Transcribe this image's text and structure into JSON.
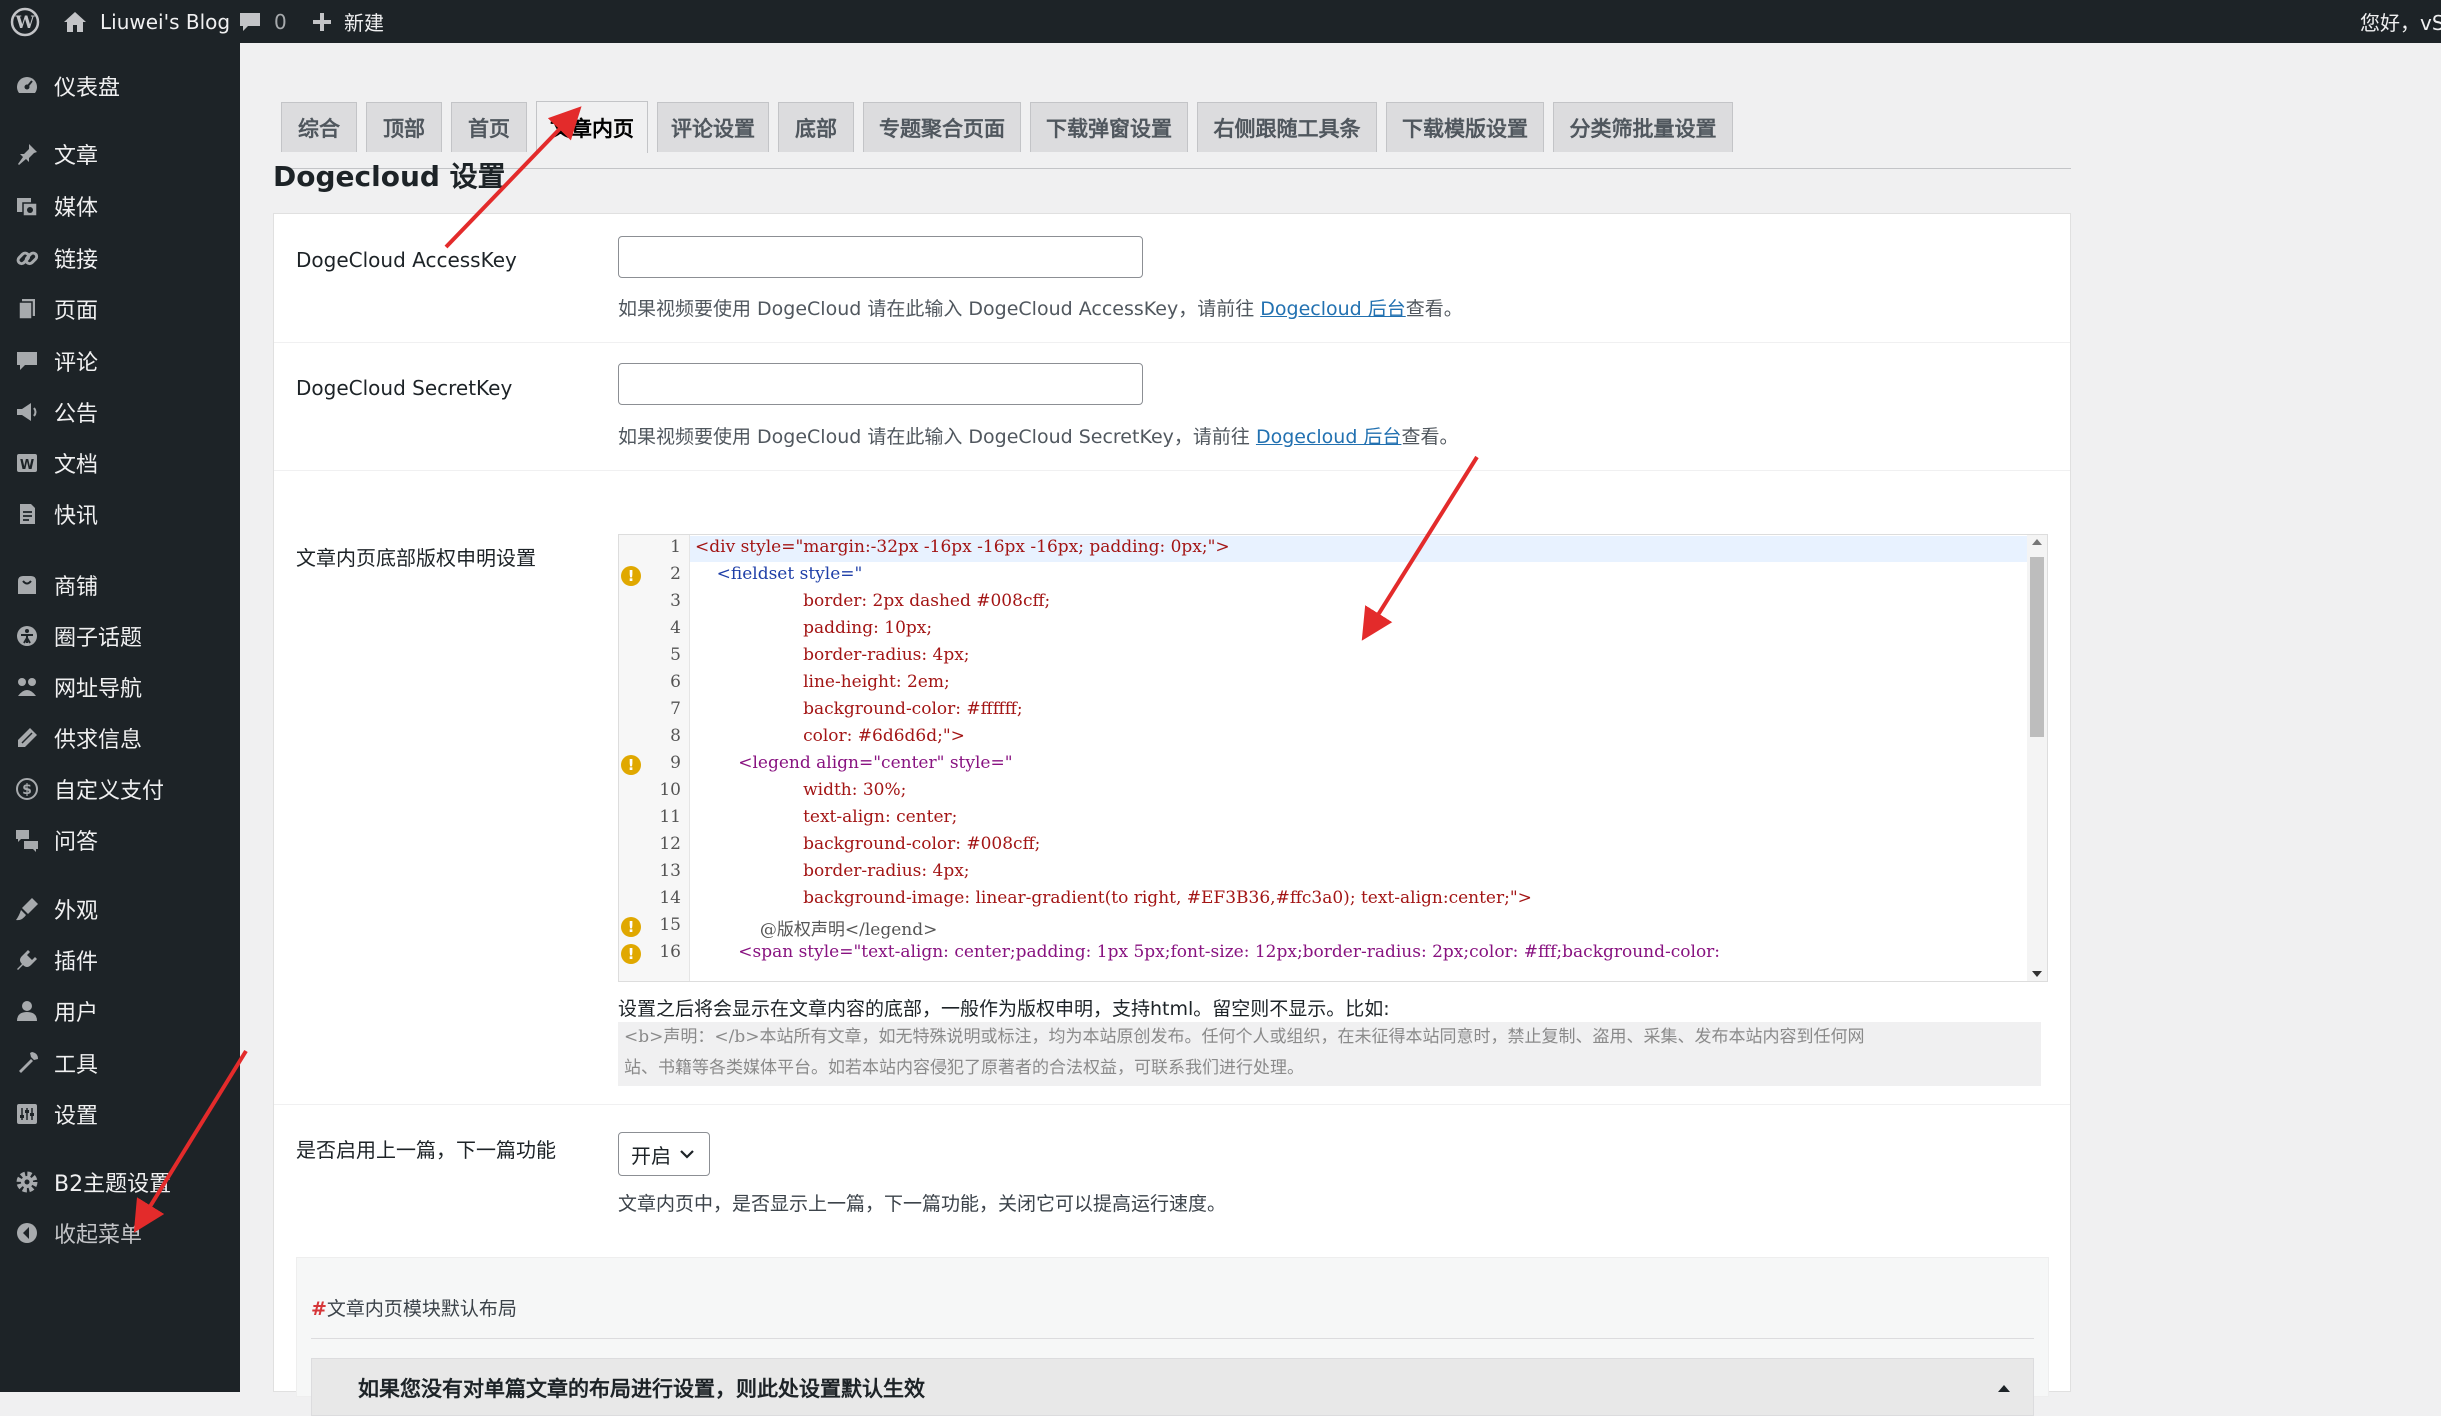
{
  "adminbar": {
    "site_name": "Liuwei's Blog",
    "comments_count": "0",
    "new_label": "新建",
    "greeting": "您好，vS"
  },
  "sidebar": {
    "items": [
      {
        "label": "仪表盘",
        "icon": "dashboard-icon"
      },
      {
        "label": "文章",
        "icon": "pushpin-icon"
      },
      {
        "label": "媒体",
        "icon": "media-icon"
      },
      {
        "label": "链接",
        "icon": "link-icon"
      },
      {
        "label": "页面",
        "icon": "page-icon"
      },
      {
        "label": "评论",
        "icon": "comment-icon"
      },
      {
        "label": "公告",
        "icon": "megaphone-icon"
      },
      {
        "label": "文档",
        "icon": "document-icon"
      },
      {
        "label": "快讯",
        "icon": "news-icon"
      },
      {
        "label": "商铺",
        "icon": "store-icon"
      },
      {
        "label": "圈子话题",
        "icon": "circle-topic-icon"
      },
      {
        "label": "网址导航",
        "icon": "navigation-icon"
      },
      {
        "label": "供求信息",
        "icon": "supply-icon"
      },
      {
        "label": "自定义支付",
        "icon": "dollar-icon"
      },
      {
        "label": "问答",
        "icon": "qa-icon"
      },
      {
        "label": "外观",
        "icon": "appearance-icon"
      },
      {
        "label": "插件",
        "icon": "plugin-icon"
      },
      {
        "label": "用户",
        "icon": "user-icon"
      },
      {
        "label": "工具",
        "icon": "wrench-icon"
      },
      {
        "label": "设置",
        "icon": "settings-icon"
      },
      {
        "label": "B2主题设置",
        "icon": "gear-icon"
      },
      {
        "label": "收起菜单",
        "icon": "collapse-icon"
      }
    ]
  },
  "tabs": [
    {
      "label": "综合"
    },
    {
      "label": "顶部"
    },
    {
      "label": "首页"
    },
    {
      "label": "文章内页",
      "active": true
    },
    {
      "label": "评论设置"
    },
    {
      "label": "底部"
    },
    {
      "label": "专题聚合页面"
    },
    {
      "label": "下载弹窗设置"
    },
    {
      "label": "右侧跟随工具条"
    },
    {
      "label": "下载模版设置"
    },
    {
      "label": "分类筛批量设置"
    }
  ],
  "page": {
    "heading": "Dogecloud 设置"
  },
  "fields": {
    "access_key": {
      "label": "DogeCloud AccessKey",
      "value": "",
      "desc_prefix": "如果视频要使用 DogeCloud 请在此输入 DogeCloud AccessKey，请前往 ",
      "link": "Dogecloud 后台",
      "desc_suffix": "查看。"
    },
    "secret_key": {
      "label": "DogeCloud SecretKey",
      "value": "",
      "desc_prefix": "如果视频要使用 DogeCloud 请在此输入 DogeCloud SecretKey，请前往 ",
      "link": "Dogecloud 后台",
      "desc_suffix": "查看。"
    },
    "copyright": {
      "label": "文章内页底部版权申明设置",
      "desc": "设置之后将会显示在文章内容的底部，一般作为版权申明，支持html。留空则不显示。比如:",
      "sample_line1": "<b>声明：</b>本站所有文章，如无特殊说明或标注，均为本站原创发布。任何个人或组织，在未征得本站同意时，禁止复制、盗用、采集、发布本站内容到任何网",
      "sample_line2": "站、书籍等各类媒体平台。如若本站内容侵犯了原著者的合法权益，可联系我们进行处理。"
    },
    "prev_next": {
      "label": "是否启用上一篇，下一篇功能",
      "selected": "开启",
      "desc": "文章内页中，是否显示上一篇，下一篇功能，关闭它可以提高运行速度。"
    }
  },
  "editor": {
    "line_numbers": [
      "1",
      "2",
      "3",
      "4",
      "5",
      "6",
      "7",
      "8",
      "9",
      "10",
      "11",
      "12",
      "13",
      "14",
      "15",
      "16"
    ],
    "lines": [
      "<div style=\"margin:-32px -16px -16px -16px; padding: 0px;\">",
      "    <fieldset style=\"",
      "                    border: 2px dashed #008cff;",
      "                    padding: 10px;",
      "                    border-radius: 4px;",
      "                    line-height: 2em;",
      "                    background-color: #ffffff;",
      "                    color: #6d6d6d;\">",
      "        <legend align=\"center\" style=\"",
      "                    width: 30%;",
      "                    text-align: center;",
      "                    background-color: #008cff;",
      "                    border-radius: 4px;",
      "                    background-image: linear-gradient(to right, #EF3B36,#ffc3a0); text-align:center;\">",
      "            @版权声明</legend>",
      "        <span style=\"text-align: center;padding: 1px 5px;font-size: 12px;border-radius: 2px;color: #fff;background-color:"
    ],
    "warnings_on": [
      "2",
      "9",
      "15",
      "16"
    ]
  },
  "module": {
    "title_hash": "#",
    "title": "文章内页模块默认布局",
    "header": "如果您没有对单篇文章的布局进行设置，则此处设置默认生效"
  },
  "colors": {
    "adminbar_bg": "#1d2327",
    "link": "#2271b1",
    "annotation_arrow": "#e32b2b"
  }
}
